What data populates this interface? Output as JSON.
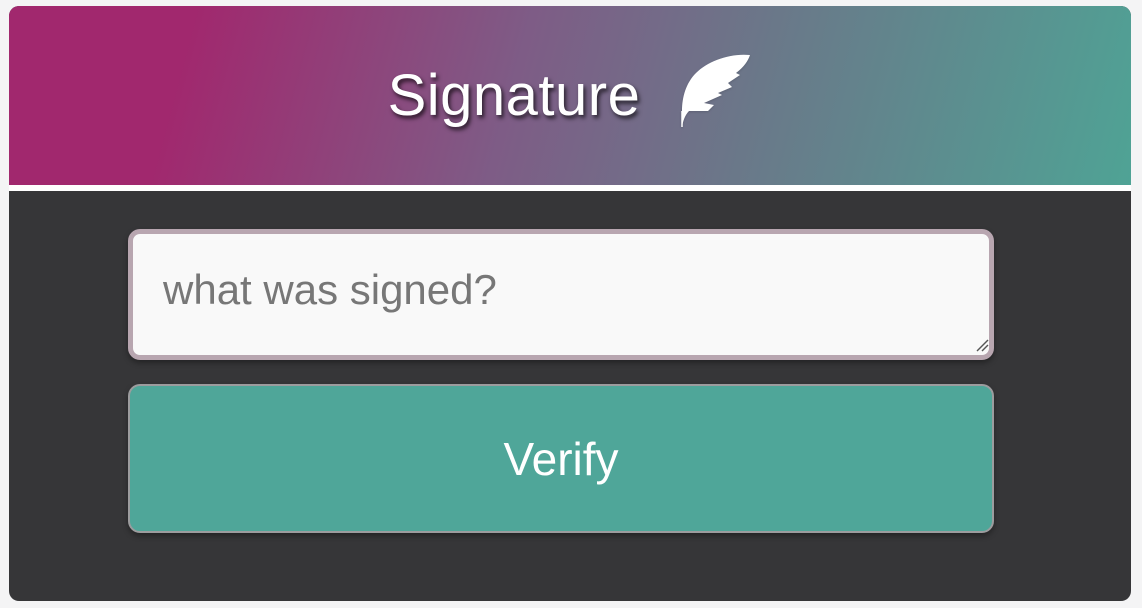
{
  "header": {
    "title": "Signature",
    "icon": "quill-icon",
    "gradient_colors": [
      "#a1286e",
      "#7e5c86",
      "#4fa395"
    ]
  },
  "form": {
    "message_placeholder": "what was signed?",
    "message_value": "",
    "verify_label": "Verify",
    "button_color": "#4fa699",
    "panel_color": "#363638"
  }
}
